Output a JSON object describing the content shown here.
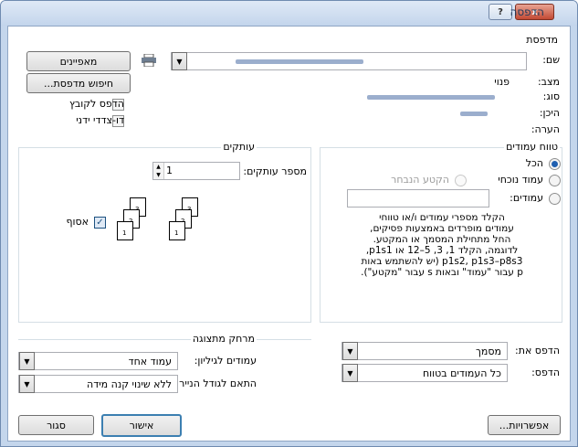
{
  "window": {
    "title": "הדפסה",
    "help_label": "?",
    "close_label": "x"
  },
  "printer": {
    "group_label": "מדפסת",
    "name_label": "שם:",
    "status_label": "מצב:",
    "status_value": "פנוי",
    "type_label": "סוג:",
    "location_label": "היכן:",
    "comment_label": "הערה:",
    "properties_button": "מאפיינים",
    "find_button": "חיפוש מדפסת...",
    "print_to_file_label": "הדפס לקובץ",
    "manual_duplex_label": "דו-צדדי ידני",
    "icons": {
      "printer": "printer-icon",
      "dropdown": "chevron-down-icon"
    }
  },
  "page_range": {
    "group_label": "טווח עמודים",
    "all_label": "הכל",
    "current_page_label": "עמוד נוכחי",
    "selection_label": "הקטע הנבחר",
    "pages_label": "עמודים:",
    "pages_value": "",
    "help_lines": [
      "הקלד מספרי עמודים ו/או טווחי",
      "עמודים מופרדים באמצעות פסיקים,",
      "החל מתחילת המסמך או המקטע.",
      "לדוגמה, הקלד 1, 3, 5–12 או p1s1,",
      "p1s2, p1s3–p8s3 (יש להשתמש באות",
      "p עבור \"עמוד\" ובאות s עבור \"מקטע\")."
    ]
  },
  "copies": {
    "group_label": "עותקים",
    "count_label": "מספר עותקים:",
    "count_value": "1",
    "collate_label": "אסוף",
    "page_numbers": [
      "3",
      "2",
      "1",
      "3",
      "2",
      "1"
    ]
  },
  "print_what": {
    "label": "הדפס את:",
    "value": "מסמך"
  },
  "print": {
    "label": "הדפס:",
    "value": "כל העמודים בטווח"
  },
  "zoom": {
    "group_label": "מרחק מתצוגה",
    "pages_per_sheet_label": "עמודים לגיליון:",
    "pages_per_sheet_value": "עמוד אחד",
    "scale_label": "התאם לגודל הנייר:",
    "scale_value": "ללא שינוי קנה מידה"
  },
  "footer": {
    "options_button": "אפשרויות...",
    "ok_button": "אישור",
    "close_button": "סגור"
  },
  "colors": {
    "accent": "#3c7fb1",
    "selected_button_border": "#3c7fb1"
  }
}
